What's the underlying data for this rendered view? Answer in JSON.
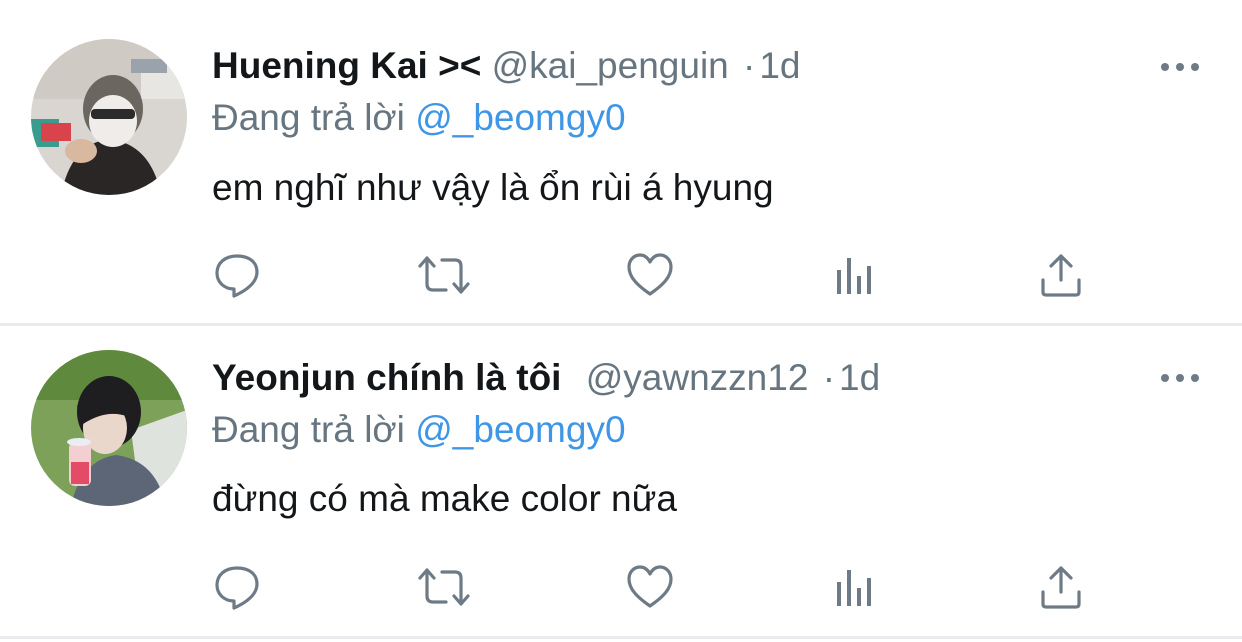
{
  "tweets": [
    {
      "display_name": "Huening Kai ><",
      "handle": "@kai_penguin",
      "separator": "·",
      "time": "1d",
      "reply_prefix": "Đang trả lời",
      "reply_to": "@_beomgy0",
      "text": "em nghĩ như vậy là ổn rùi á hyung"
    },
    {
      "display_name": "Yeonjun chính là tôi",
      "handle": "@yawnzzn12",
      "separator": "·",
      "time": "1d",
      "reply_prefix": "Đang trả lời",
      "reply_to": "@_beomgy0",
      "text": "đừng có mà make color nữa"
    }
  ],
  "icons": {
    "more": "more-horizontal-icon",
    "reply": "reply-bubble-icon",
    "retweet": "retweet-icon",
    "like": "heart-icon",
    "analytics": "analytics-bars-icon",
    "share": "share-upload-icon"
  },
  "colors": {
    "text_primary": "#14171a",
    "text_secondary": "#66757f",
    "mention": "#3f96e6",
    "icon": "#6e7b86",
    "divider": "#e9ecef"
  }
}
